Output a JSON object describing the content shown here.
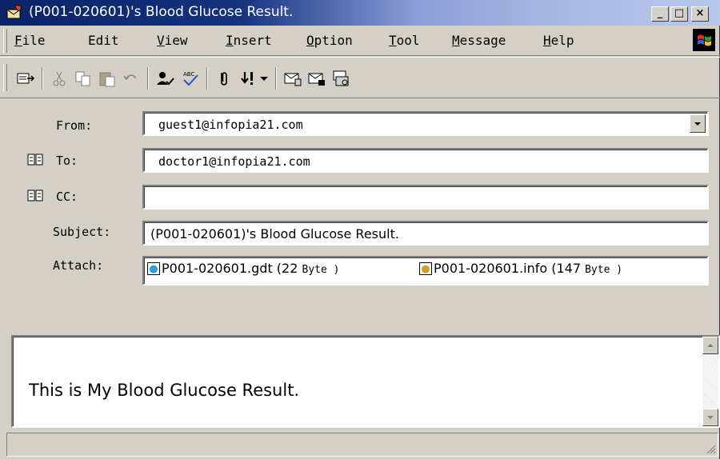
{
  "window": {
    "title": "(P001-020601)'s Blood Glucose Result.",
    "controls": {
      "minimize": "_",
      "maximize": "□",
      "close": "×"
    }
  },
  "menu": {
    "items": [
      {
        "accel": "F",
        "rest": "ile"
      },
      {
        "accel": "",
        "rest": "Edit"
      },
      {
        "accel": "V",
        "rest": "iew"
      },
      {
        "accel": "I",
        "rest": "nsert"
      },
      {
        "accel": "O",
        "rest": "ption"
      },
      {
        "accel": "T",
        "rest": "ool"
      },
      {
        "accel": "M",
        "rest": "essage"
      },
      {
        "accel": "H",
        "rest": "elp"
      }
    ]
  },
  "toolbar": {
    "icons": [
      "send-icon",
      "cut-icon",
      "copy-icon",
      "paste-icon",
      "undo-icon",
      "check-names-icon",
      "spelling-icon",
      "attach-icon",
      "priority-icon",
      "priority-dropdown-icon",
      "sign-icon",
      "encrypt-icon",
      "offline-icon"
    ]
  },
  "header": {
    "from_label": "From:",
    "from_value": "guest1@infopia21.com",
    "to_label": "To:",
    "to_value": "doctor1@infopia21.com",
    "cc_label": "CC:",
    "cc_value": "",
    "subject_label": "Subject:",
    "subject_value": "(P001-020601)'s Blood Glucose Result.",
    "attach_label": "Attach:",
    "attachments": [
      {
        "name": "P001-020601.gdt (22",
        "size_unit": "Byte )"
      },
      {
        "name": "P001-020601.info (147",
        "size_unit": "Byte )"
      }
    ]
  },
  "body": {
    "text": "This is My Blood Glucose Result."
  },
  "colors": {
    "titlebar_start": "#0a246a",
    "titlebar_end": "#b8c8ec",
    "face": "#d4d0c8"
  }
}
